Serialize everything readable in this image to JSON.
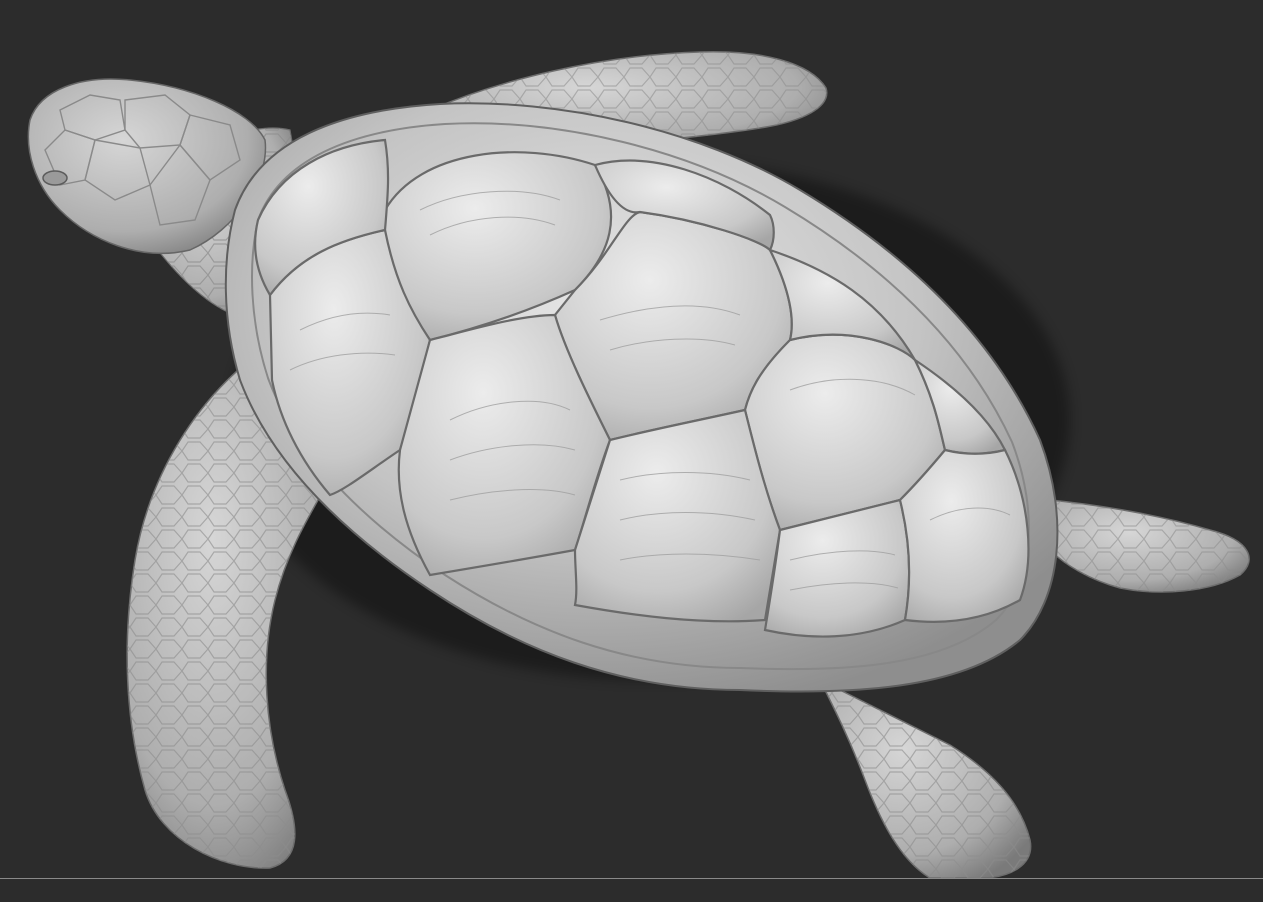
{
  "viewport": {
    "background_color": "#2c2c2c",
    "model": {
      "subject": "sea-turtle-sculpt",
      "material_color": "#bdbdbd"
    }
  }
}
